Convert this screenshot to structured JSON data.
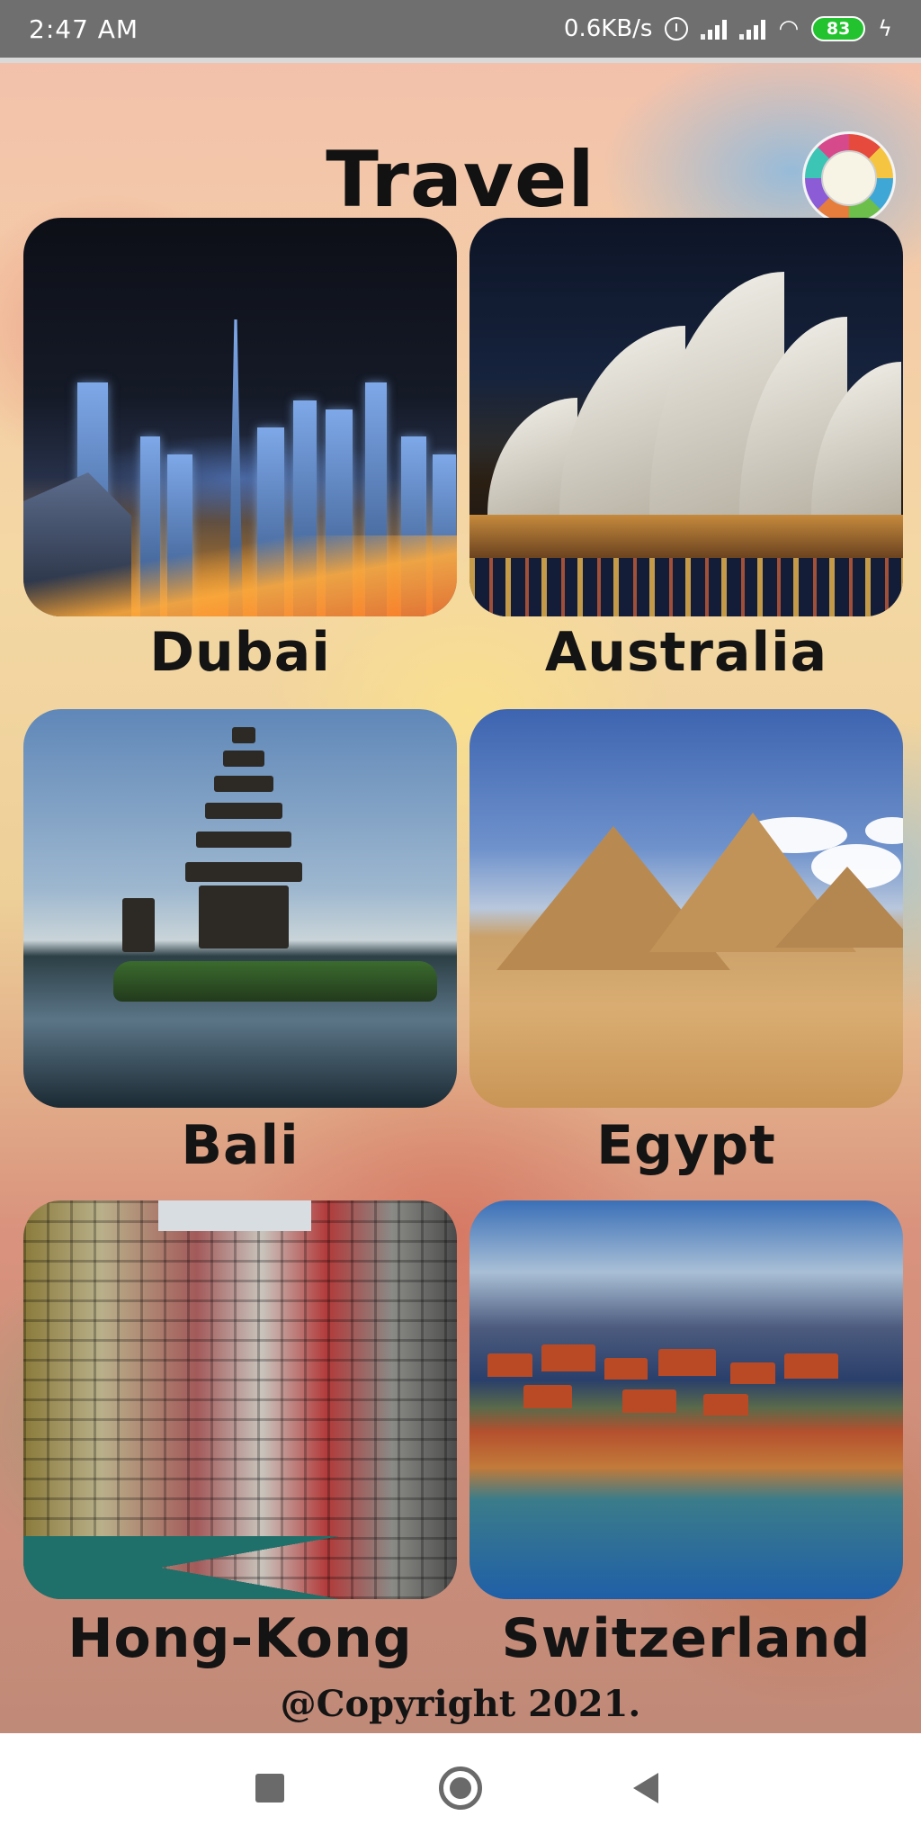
{
  "status_bar": {
    "time": "2:47 AM",
    "network_speed": "0.6KB/s",
    "battery_level": "83",
    "icons": [
      "alarm-icon",
      "signal-icon",
      "signal-icon",
      "wifi-icon",
      "battery-icon",
      "charging-icon"
    ]
  },
  "header": {
    "title": "Travel",
    "logo_icon": "travel-globe-logo"
  },
  "destinations": [
    {
      "label": "Dubai"
    },
    {
      "label": "Australia"
    },
    {
      "label": "Bali"
    },
    {
      "label": "Egypt"
    },
    {
      "label": "Hong-Kong"
    },
    {
      "label": "Switzerland"
    }
  ],
  "footer": {
    "copyright": "@Copyright 2021."
  },
  "nav_bar": {
    "icons": [
      "recent-apps-icon",
      "home-icon",
      "back-icon"
    ]
  },
  "colors": {
    "status_bar_bg": "#6f6f6f",
    "battery_green": "#22c32e",
    "text_dark": "#141414",
    "nav_icon": "#6a6a6a"
  }
}
